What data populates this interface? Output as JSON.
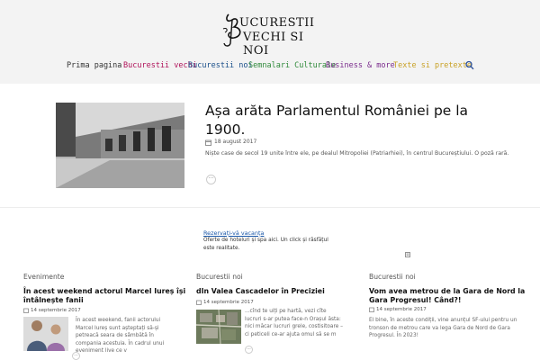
{
  "site": {
    "logo_line1": "UCURESTII",
    "logo_line2": "VECHI SI NOI"
  },
  "nav": {
    "items": [
      {
        "label": "Prima pagina",
        "color": "#333333"
      },
      {
        "label": "Bucurestii vechi",
        "color": "#b0135a"
      },
      {
        "label": "Bucurestii noi",
        "color": "#1a4f8a"
      },
      {
        "label": "Semnalari Culturale",
        "color": "#2f8a3a"
      },
      {
        "label": "Business & more",
        "color": "#7a2b8c"
      },
      {
        "label": "Texte si pretexte",
        "color": "#c9a227"
      }
    ]
  },
  "featured": {
    "title": "Așa arăta Parlamentul României pe la 1900.",
    "date": "18 august 2017",
    "excerpt": "Niște case de secol 19 unite între ele, pe dealul Mitropoliei (Patriarhiei), în centrul Bucureștiului. O poză rară.",
    "more": "···"
  },
  "ad": {
    "link": "Rezervați-vă vacanța",
    "text": "Oferte de hoteluri și spa aici. Un click și răsfățul este realitate."
  },
  "columns": [
    {
      "category": "Evenimente",
      "title": "În acest weekend actorul Marcel Iureș își întâlnește fanii",
      "date": "14 septembrie 2017",
      "excerpt": "În acest weekend, fanii actorului Marcel Iureș sunt așteptați să-și petreacă seara de sâmbătă în compania acestuia. În cadrul unui eveniment live ce v",
      "more": "···"
    },
    {
      "category": "Bucurestii noi",
      "title": "dIn Valea Cascadelor în Preciziei",
      "date": "14 septembrie 2017",
      "excerpt": "...cînd te uiți pe hartă, vezi cîte lucruri s-ar putea face-n Orașul ăsta: nici măcar lucruri grele, costisitoare – ci peticeli ce-ar ajuta omul să se m",
      "more": "···"
    },
    {
      "category": "Bucurestii noi",
      "title": "Vom avea metrou de la Gara de Nord la Gara Progresul! Când?!",
      "date": "14 septembrie 2017",
      "excerpt": "El bine, în aceste condiții, vine anunțul SF-ului pentru un tronson de metrou care va lega Gara de Nord de Gara Progresul. În 2023!"
    }
  ]
}
